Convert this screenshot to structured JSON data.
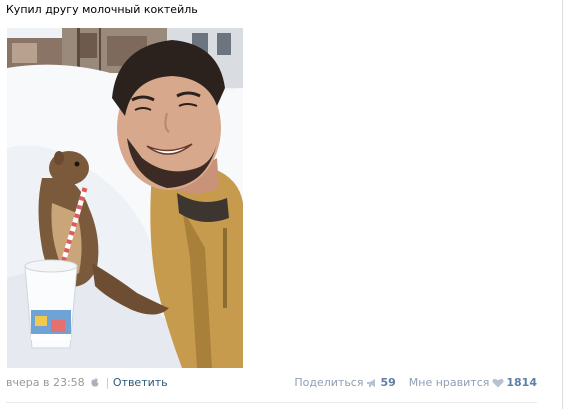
{
  "post": {
    "text": "Купил другу молочный коктейль"
  },
  "footer": {
    "date": "вчера в 23:58",
    "separator": "|",
    "reply_label": "Ответить",
    "share_label": "Поделиться",
    "share_count": "59",
    "like_label": "Мне нравится",
    "like_count": "1814"
  },
  "icons": {
    "device": "apple-icon",
    "share": "megaphone-icon",
    "like": "heart-icon"
  },
  "colors": {
    "link": "#2b587a",
    "muted": "#999999",
    "counter": "#5b7fa6",
    "icon": "#b5c2d0"
  }
}
